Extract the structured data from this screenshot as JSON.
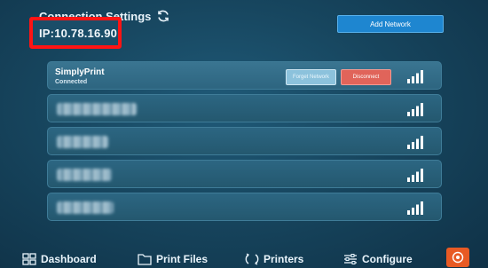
{
  "header": {
    "title": "Connection Settings",
    "ip_text": "IP:10.78.16.90"
  },
  "toolbar": {
    "add_network_label": "Add Network"
  },
  "networks": [
    {
      "name": "SimplyPrint",
      "status": "Connected",
      "forget_label": "Forget Network",
      "disconnect_label": "Disconnect",
      "icon": "wifi-signal-icon"
    },
    {
      "icon": "wifi-signal-icon"
    },
    {
      "icon": "wifi-signal-icon"
    },
    {
      "icon": "wifi-signal-icon"
    },
    {
      "icon": "wifi-signal-icon"
    }
  ],
  "nav": {
    "dashboard": "Dashboard",
    "print_files": "Print Files",
    "printers": "Printers",
    "configure": "Configure"
  },
  "colors": {
    "accent": "#1e86d0",
    "danger": "#e0645a",
    "power": "#e85a24",
    "highlight": "#ff1414"
  }
}
